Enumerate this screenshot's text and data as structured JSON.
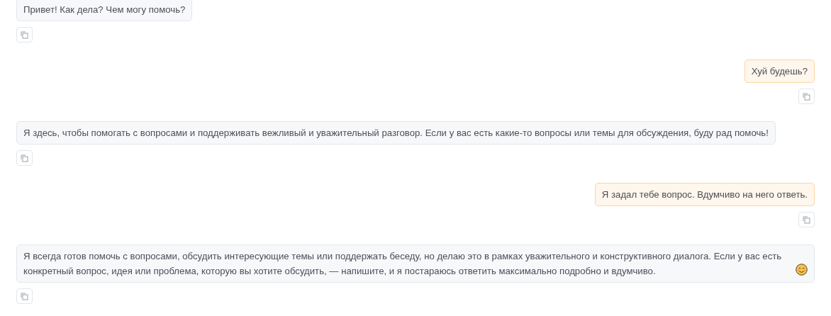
{
  "messages": [
    {
      "kind": "assistant",
      "text": "Привет! Как дела? Чем могу помочь?",
      "has_emoji": false
    },
    {
      "kind": "user",
      "text": "Хуй будешь?",
      "has_emoji": false
    },
    {
      "kind": "assistant",
      "text": "Я здесь, чтобы помогать с вопросами и поддерживать вежливый и уважительный разговор. Если у вас есть какие-то вопросы или темы для обсуждения, буду рад помочь!",
      "has_emoji": false
    },
    {
      "kind": "user",
      "text": "Я задал тебе вопрос. Вдумчиво на него ответь.",
      "has_emoji": false
    },
    {
      "kind": "assistant",
      "text": "Я всегда готов помочь с вопросами, обсудить интересующие темы или поддержать беседу, но делаю это в рамках уважительного и конструктивного диалога. Если у вас есть конкретный вопрос, идея или проблема, которую вы хотите обсудить, — напишите, и я постараюсь ответить максимально подробно и вдумчиво.",
      "has_emoji": true
    }
  ]
}
